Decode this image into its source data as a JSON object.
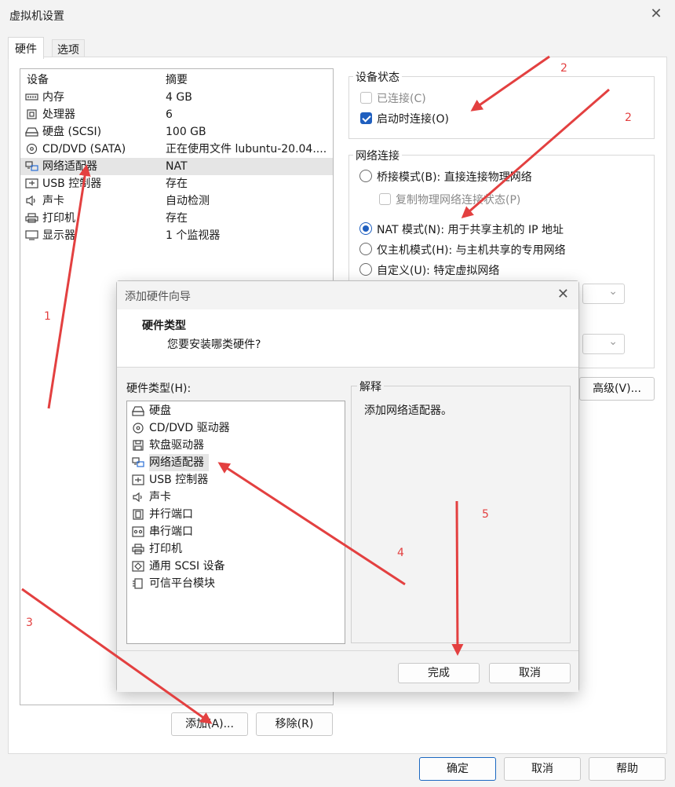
{
  "window": {
    "title": "虚拟机设置"
  },
  "tabs": {
    "hardware": "硬件",
    "options": "选项"
  },
  "device_list": {
    "col_device": "设备",
    "col_summary": "摘要",
    "rows": [
      {
        "name": "内存",
        "summary": "4 GB",
        "icon": "memory-icon"
      },
      {
        "name": "处理器",
        "summary": "6",
        "icon": "cpu-icon"
      },
      {
        "name": "硬盘 (SCSI)",
        "summary": "100 GB",
        "icon": "harddisk-icon"
      },
      {
        "name": "CD/DVD (SATA)",
        "summary": "正在使用文件 lubuntu-20.04....",
        "icon": "cdrom-icon"
      },
      {
        "name": "网络适配器",
        "summary": "NAT",
        "icon": "network-adapter-icon"
      },
      {
        "name": "USB 控制器",
        "summary": "存在",
        "icon": "usb-icon"
      },
      {
        "name": "声卡",
        "summary": "自动检测",
        "icon": "speaker-icon"
      },
      {
        "name": "打印机",
        "summary": "存在",
        "icon": "printer-icon"
      },
      {
        "name": "显示器",
        "summary": "1 个监视器",
        "icon": "monitor-icon"
      }
    ],
    "selected_index": 4
  },
  "device_status": {
    "title": "设备状态",
    "connected": "已连接(C)",
    "connect_at_power_on": "启动时连接(O)"
  },
  "network": {
    "title": "网络连接",
    "bridged": "桥接模式(B): 直接连接物理网络",
    "replicate": "复制物理网络连接状态(P)",
    "nat": "NAT 模式(N): 用于共享主机的 IP 地址",
    "host_only": "仅主机模式(H): 与主机共享的专用网络",
    "custom": "自定义(U): 特定虚拟网络",
    "advanced_button": "高级(V)..."
  },
  "left_buttons": {
    "add": "添加(A)...",
    "remove": "移除(R)"
  },
  "bottom_buttons": {
    "ok": "确定",
    "cancel": "取消",
    "help": "帮助"
  },
  "wizard": {
    "title": "添加硬件向导",
    "header_title": "硬件类型",
    "header_subtitle": "您要安装哪类硬件?",
    "list_label": "硬件类型(H):",
    "explain_title": "解释",
    "explain_text": "添加网络适配器。",
    "items": [
      {
        "label": "硬盘",
        "icon": "harddisk-icon"
      },
      {
        "label": "CD/DVD 驱动器",
        "icon": "cdrom-icon"
      },
      {
        "label": "软盘驱动器",
        "icon": "floppy-icon"
      },
      {
        "label": "网络适配器",
        "icon": "network-adapter-icon"
      },
      {
        "label": "USB 控制器",
        "icon": "usb-icon"
      },
      {
        "label": "声卡",
        "icon": "speaker-icon"
      },
      {
        "label": "并行端口",
        "icon": "parallel-port-icon"
      },
      {
        "label": "串行端口",
        "icon": "serial-port-icon"
      },
      {
        "label": "打印机",
        "icon": "printer-icon"
      },
      {
        "label": "通用 SCSI 设备",
        "icon": "scsi-device-icon"
      },
      {
        "label": "可信平台模块",
        "icon": "tpm-icon"
      }
    ],
    "selected_index": 3,
    "finish": "完成",
    "cancel": "取消"
  },
  "annotations": {
    "n1": "1",
    "n2a": "2",
    "n2b": "2",
    "n3": "3",
    "n4": "4",
    "n5": "5"
  },
  "colors": {
    "accent": "#1f5fbf",
    "annotation": "#e34040"
  }
}
